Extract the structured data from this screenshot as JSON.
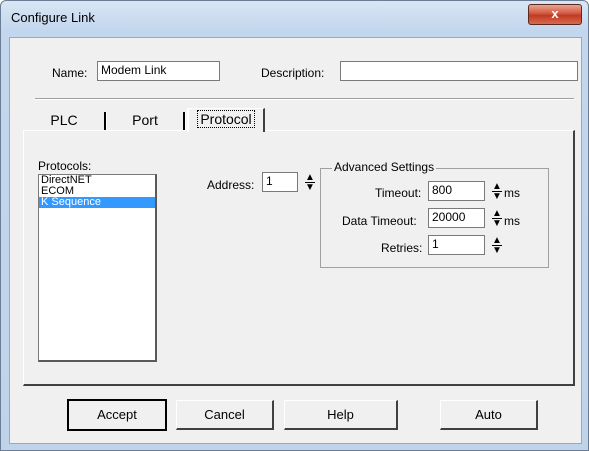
{
  "window": {
    "title": "Configure Link",
    "close_glyph": "x"
  },
  "name_field": {
    "label": "Name:",
    "value": "Modem Link"
  },
  "description_field": {
    "label": "Description:",
    "value": ""
  },
  "tabs": [
    {
      "label": "PLC"
    },
    {
      "label": "Port"
    },
    {
      "label": "Protocol",
      "selected": true
    }
  ],
  "protocols": {
    "label": "Protocols:",
    "items": [
      "DirectNET",
      "ECOM",
      "K Sequence"
    ],
    "selected": "K Sequence"
  },
  "address": {
    "label": "Address:",
    "value": "1"
  },
  "advanced": {
    "title": "Advanced Settings",
    "timeout": {
      "label": "Timeout:",
      "value": "800",
      "unit": "ms"
    },
    "data_timeout": {
      "label": "Data Timeout:",
      "value": "20000",
      "unit": "ms"
    },
    "retries": {
      "label": "Retries:",
      "value": "1"
    }
  },
  "buttons": {
    "accept": "Accept",
    "cancel": "Cancel",
    "help": "Help",
    "auto": "Auto"
  },
  "colors": {
    "selection": "#3399ff",
    "close_button": "#c13a22",
    "dialog_bg": "#f0f0f0"
  },
  "icons": {
    "spinner": "up-down-arrows-icon",
    "close": "close-icon"
  }
}
